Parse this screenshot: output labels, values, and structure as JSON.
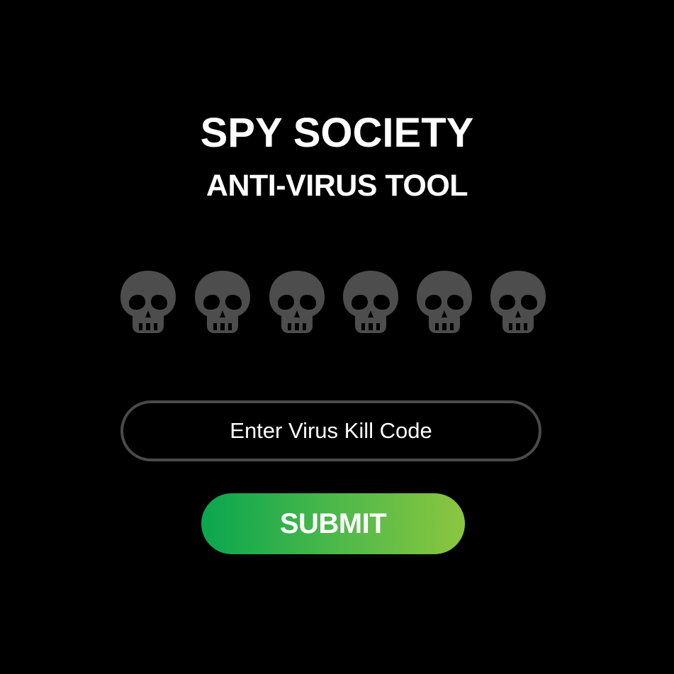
{
  "header": {
    "title": "SPY SOCIETY",
    "subtitle": "ANTI-VIRUS TOOL"
  },
  "virus_indicators": {
    "icon": "skull-icon",
    "color": "#4d4d4d",
    "count": 6
  },
  "code_input": {
    "placeholder": "Enter Virus Kill Code",
    "value": ""
  },
  "submit": {
    "label": "SUBMIT",
    "gradient_start": "#0aa64f",
    "gradient_end": "#8cc63f"
  },
  "colors": {
    "background": "#000000",
    "text": "#ffffff",
    "input_border": "#4a4a4a"
  }
}
